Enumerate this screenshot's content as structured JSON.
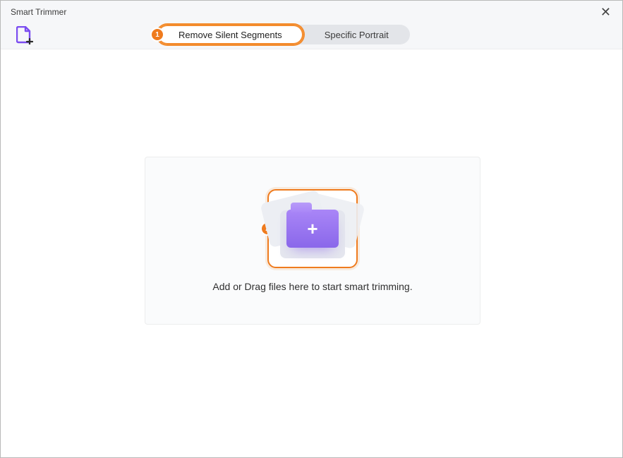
{
  "window": {
    "title": "Smart Trimmer"
  },
  "tabs": {
    "remove_silent": "Remove Silent Segments",
    "specific_portrait": "Specific Portrait"
  },
  "badges": {
    "step1": "1",
    "step2": "2"
  },
  "dropzone": {
    "instruction": "Add or Drag files here to start smart trimming."
  }
}
